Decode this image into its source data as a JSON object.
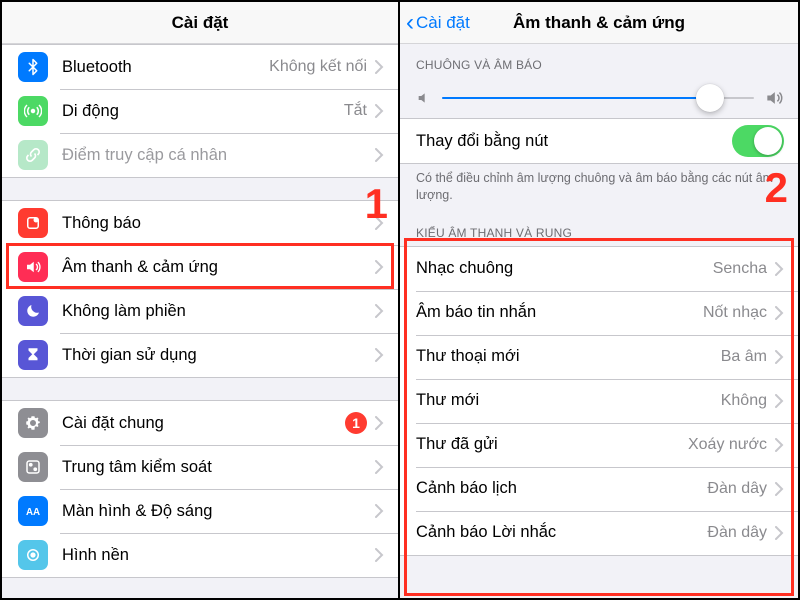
{
  "annotations": {
    "step1": "1",
    "step2": "2"
  },
  "left": {
    "title": "Cài đặt",
    "group1": [
      {
        "id": "bluetooth",
        "label": "Bluetooth",
        "value": "Không kết nối",
        "iconBg": "#007aff",
        "dim": false
      },
      {
        "id": "cellular",
        "label": "Di động",
        "value": "Tắt",
        "iconBg": "#4cd964",
        "dim": false
      },
      {
        "id": "hotspot",
        "label": "Điểm truy cập cá nhân",
        "value": "",
        "iconBg": "#9fe0b9",
        "dim": true
      }
    ],
    "group2": [
      {
        "id": "notifications",
        "label": "Thông báo",
        "iconBg": "#ff3b30"
      },
      {
        "id": "sounds",
        "label": "Âm thanh & cảm ứng",
        "iconBg": "#ff2d55"
      },
      {
        "id": "dnd",
        "label": "Không làm phiền",
        "iconBg": "#5856d6"
      },
      {
        "id": "screentime",
        "label": "Thời gian sử dụng",
        "iconBg": "#5856d6"
      }
    ],
    "group3": [
      {
        "id": "general",
        "label": "Cài đặt chung",
        "iconBg": "#8e8e93",
        "badge": "1"
      },
      {
        "id": "control",
        "label": "Trung tâm kiểm soát",
        "iconBg": "#8e8e93"
      },
      {
        "id": "display",
        "label": "Màn hình & Độ sáng",
        "iconBg": "#007aff"
      },
      {
        "id": "wallpaper",
        "label": "Hình nền",
        "iconBg": "#54c6ea"
      }
    ]
  },
  "right": {
    "back": "Cài đặt",
    "title": "Âm thanh & cảm ứng",
    "section1_label": "CHUÔNG VÀ ÂM BÁO",
    "slider_value": 0.86,
    "change_with_buttons": {
      "label": "Thay đổi bằng nút",
      "on": true
    },
    "desc": "Có thể điều chỉnh âm lượng chuông và âm báo bằng các nút âm lượng.",
    "section2_label": "KIỂU ÂM THANH VÀ RUNG",
    "items": [
      {
        "label": "Nhạc chuông",
        "value": "Sencha"
      },
      {
        "label": "Âm báo tin nhắn",
        "value": "Nốt nhạc"
      },
      {
        "label": "Thư thoại mới",
        "value": "Ba âm"
      },
      {
        "label": "Thư mới",
        "value": "Không"
      },
      {
        "label": "Thư đã gửi",
        "value": "Xoáy nước"
      },
      {
        "label": "Cảnh báo lịch",
        "value": "Đàn dây"
      },
      {
        "label": "Cảnh báo Lời nhắc",
        "value": "Đàn dây"
      }
    ]
  }
}
